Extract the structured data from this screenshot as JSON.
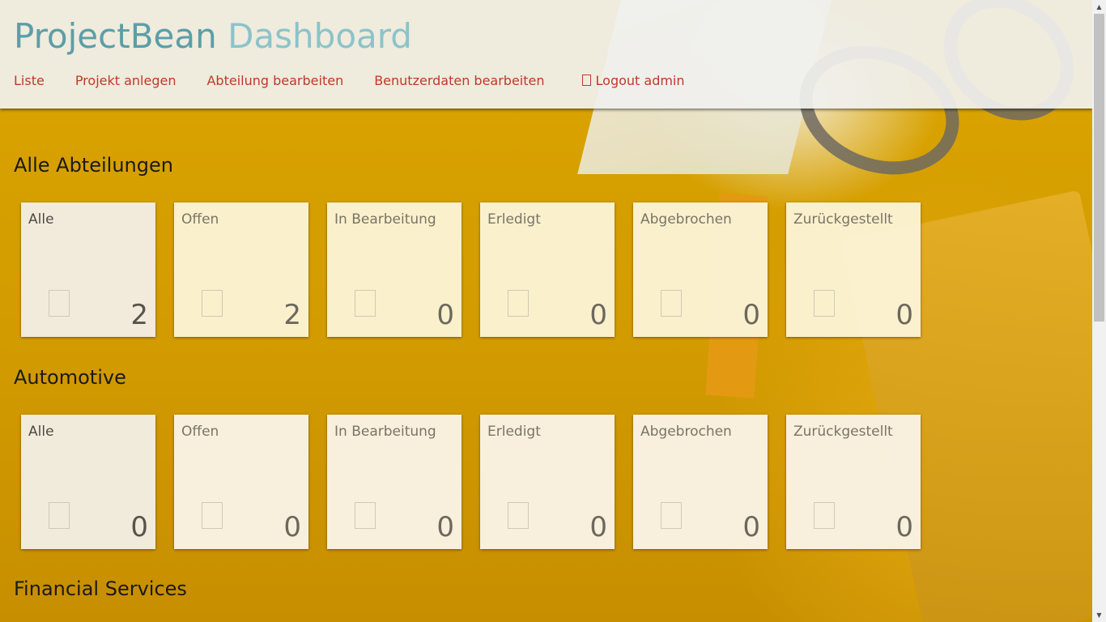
{
  "app": {
    "brand_primary": "ProjectBean",
    "brand_secondary": "Dashboard"
  },
  "nav": {
    "items": [
      {
        "label": "Liste"
      },
      {
        "label": "Projekt anlegen"
      },
      {
        "label": "Abteilung bearbeiten"
      },
      {
        "label": "Benutzerdaten bearbeiten"
      }
    ],
    "logout_label": "Logout admin"
  },
  "sections": [
    {
      "title": "Alle Abteilungen",
      "cards": [
        {
          "label": "Alle",
          "count": "2"
        },
        {
          "label": "Offen",
          "count": "2"
        },
        {
          "label": "In Bearbeitung",
          "count": "0"
        },
        {
          "label": "Erledigt",
          "count": "0"
        },
        {
          "label": "Abgebrochen",
          "count": "0"
        },
        {
          "label": "Zurückgestellt",
          "count": "0"
        }
      ]
    },
    {
      "title": "Automotive",
      "cards": [
        {
          "label": "Alle",
          "count": "0"
        },
        {
          "label": "Offen",
          "count": "0"
        },
        {
          "label": "In Bearbeitung",
          "count": "0"
        },
        {
          "label": "Erledigt",
          "count": "0"
        },
        {
          "label": "Abgebrochen",
          "count": "0"
        },
        {
          "label": "Zurückgestellt",
          "count": "0"
        }
      ]
    },
    {
      "title": "Financial Services",
      "cards": []
    }
  ],
  "colors": {
    "brand_primary": "#5c9ea8",
    "brand_secondary": "#8cc3c9",
    "nav_link": "#c0392b",
    "background_accent": "#d9a300"
  }
}
